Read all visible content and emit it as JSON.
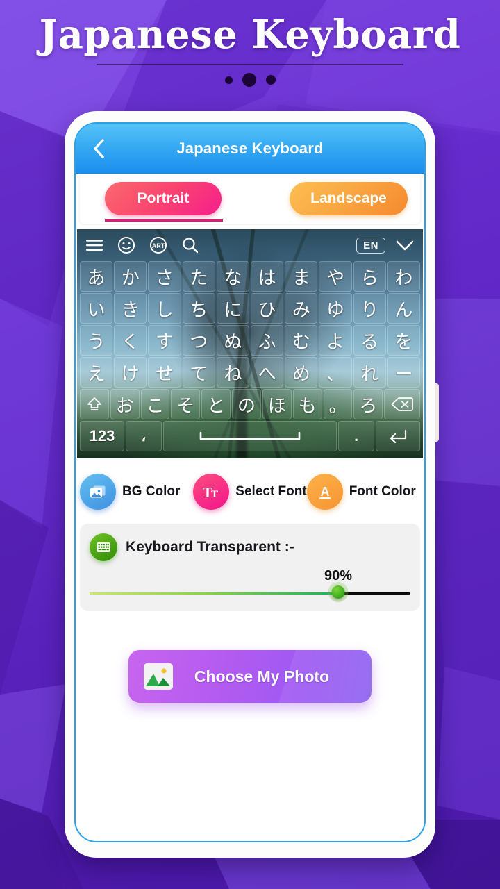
{
  "page": {
    "title": "Japanese Keyboard",
    "dots": [
      "small-dot",
      "large-dot",
      "medium-dot"
    ]
  },
  "header": {
    "back_icon": "chevron-left-icon",
    "title": "Japanese Keyboard"
  },
  "tabs": {
    "portrait_label": "Portrait",
    "landscape_label": "Landscape",
    "selected": "Portrait",
    "portrait_color": "#f9456f",
    "landscape_color": "#f9a23f",
    "underline_color": "#e0197e"
  },
  "keyboard": {
    "toolbar": {
      "menu_icon": "hamburger-menu-icon",
      "emoji_icon": "smiley-icon",
      "art_icon": "art-circle-icon",
      "art_label": "ART",
      "search_icon": "search-icon",
      "language_badge": "EN",
      "collapse_icon": "chevron-down-icon"
    },
    "rows": [
      [
        "あ",
        "か",
        "さ",
        "た",
        "な",
        "は",
        "ま",
        "や",
        "ら",
        "わ"
      ],
      [
        "い",
        "き",
        "し",
        "ち",
        "に",
        "ひ",
        "み",
        "ゆ",
        "り",
        "ん"
      ],
      [
        "う",
        "く",
        "す",
        "つ",
        "ぬ",
        "ふ",
        "む",
        "よ",
        "る",
        "を"
      ],
      [
        "え",
        "け",
        "せ",
        "て",
        "ね",
        "へ",
        "め",
        "、",
        "れ",
        "ー"
      ]
    ],
    "row5": {
      "shift_icon": "shift-up-icon",
      "keys": [
        "お",
        "こ",
        "そ",
        "と",
        "の",
        "ほ",
        "も",
        "。",
        "ろ"
      ],
      "backspace_icon": "backspace-delete-icon"
    },
    "row6": {
      "numeric_label": "123",
      "comma_label": "،",
      "space_icon": "space-bar-icon",
      "period_label": ".",
      "enter_icon": "enter-return-icon"
    }
  },
  "options": [
    {
      "id": "bg-color",
      "label": "BG Color",
      "icon": "image-picture-icon",
      "color": "#3f8fe0"
    },
    {
      "id": "select-font",
      "label": "Select Font",
      "icon": "text-format-tt-icon",
      "color": "#f3138c"
    },
    {
      "id": "font-color",
      "label": "Font Color",
      "icon": "letter-a-underline-icon",
      "color": "#f79333"
    }
  ],
  "transparency": {
    "icon": "keyboard-grid-icon",
    "label": "Keyboard Transparent :-",
    "value_label": "90%",
    "value": 90,
    "min": 0,
    "max": 100,
    "fill_color": "#16b45c"
  },
  "choose_photo": {
    "label": "Choose My Photo",
    "icon": "photo-gallery-icon",
    "color": "#b45bf0"
  }
}
